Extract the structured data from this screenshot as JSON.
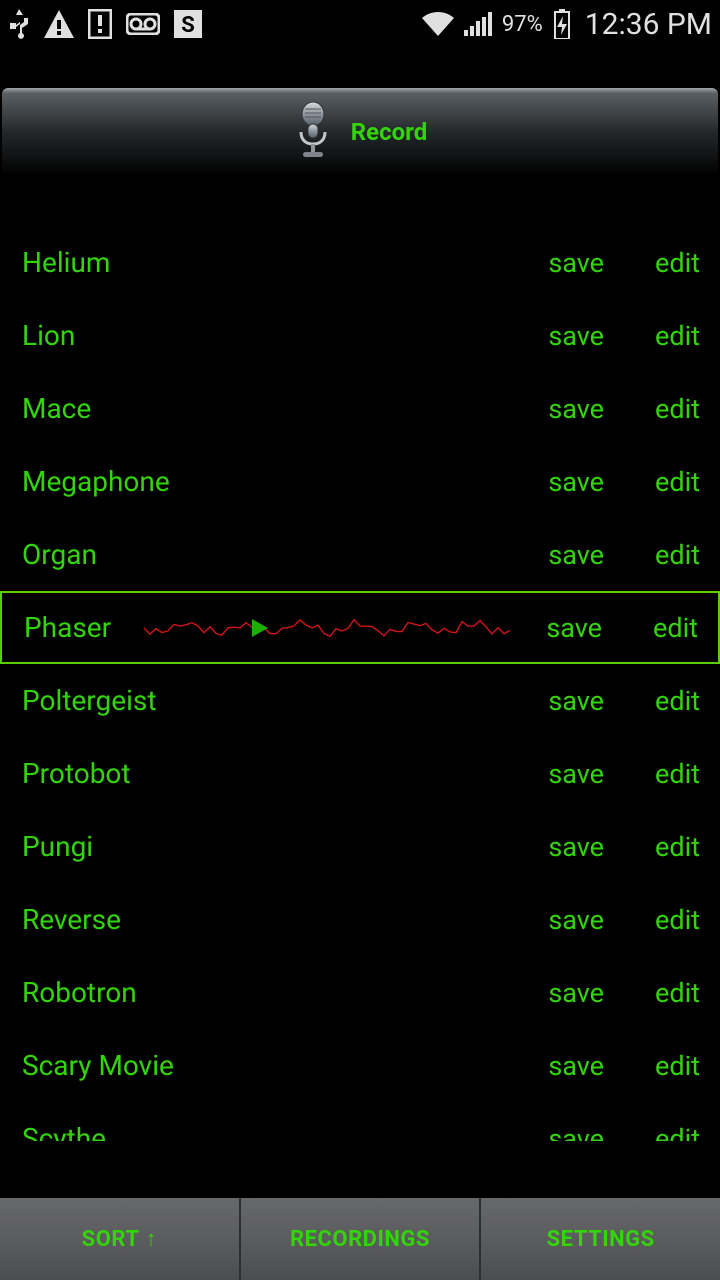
{
  "status_bar": {
    "battery_pct": "97%",
    "time": "12:36 PM"
  },
  "record_button": {
    "label": "Record"
  },
  "effects": [
    {
      "name": "Helium",
      "save": "save",
      "edit": "edit",
      "selected": false
    },
    {
      "name": "Lion",
      "save": "save",
      "edit": "edit",
      "selected": false
    },
    {
      "name": "Mace",
      "save": "save",
      "edit": "edit",
      "selected": false
    },
    {
      "name": "Megaphone",
      "save": "save",
      "edit": "edit",
      "selected": false
    },
    {
      "name": "Organ",
      "save": "save",
      "edit": "edit",
      "selected": false
    },
    {
      "name": "Phaser",
      "save": "save",
      "edit": "edit",
      "selected": true
    },
    {
      "name": "Poltergeist",
      "save": "save",
      "edit": "edit",
      "selected": false
    },
    {
      "name": "Protobot",
      "save": "save",
      "edit": "edit",
      "selected": false
    },
    {
      "name": "Pungi",
      "save": "save",
      "edit": "edit",
      "selected": false
    },
    {
      "name": "Reverse",
      "save": "save",
      "edit": "edit",
      "selected": false
    },
    {
      "name": "Robotron",
      "save": "save",
      "edit": "edit",
      "selected": false
    },
    {
      "name": "Scary Movie",
      "save": "save",
      "edit": "edit",
      "selected": false
    },
    {
      "name": "Scythe",
      "save": "save",
      "edit": "edit",
      "selected": false
    }
  ],
  "bottom_nav": {
    "sort": "SORT",
    "sort_arrow": "↑",
    "recordings": "RECORDINGS",
    "settings": "SETTINGS"
  }
}
